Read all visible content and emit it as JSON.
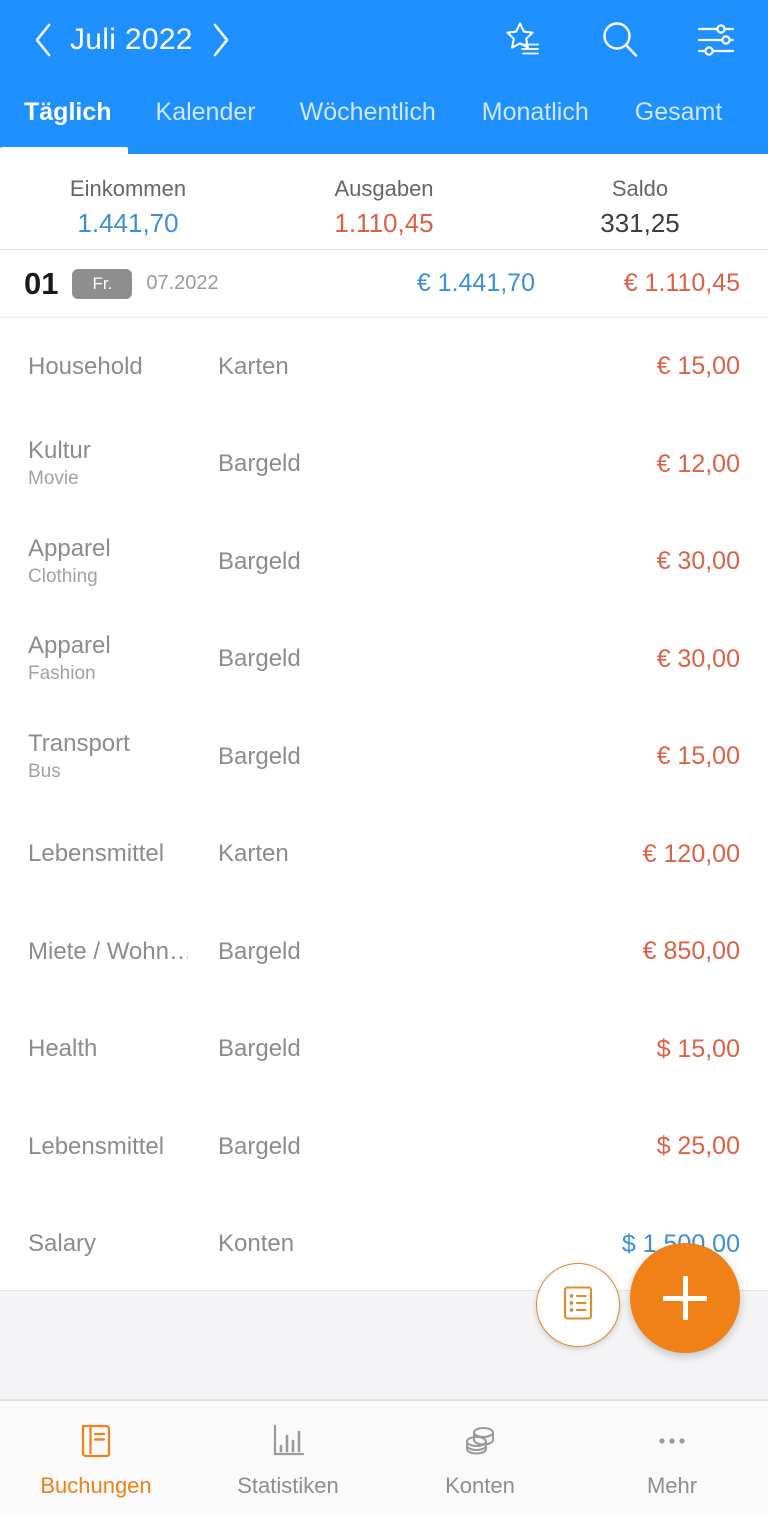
{
  "header": {
    "month_label": "Juli 2022",
    "prev_icon": "chevron-left-icon",
    "next_icon": "chevron-right-icon",
    "icons": [
      {
        "name": "star-list-icon",
        "label": "Favoriten"
      },
      {
        "name": "search-icon",
        "label": "Suche"
      },
      {
        "name": "filter-sliders-icon",
        "label": "Filter"
      }
    ],
    "accent_color": "#1E90FF"
  },
  "tabs": [
    {
      "label": "Täglich",
      "active": true
    },
    {
      "label": "Kalender",
      "active": false
    },
    {
      "label": "Wöchentlich",
      "active": false
    },
    {
      "label": "Monatlich",
      "active": false
    },
    {
      "label": "Gesamt",
      "active": false
    }
  ],
  "summary": {
    "income": {
      "label": "Einkommen",
      "value": "1.441,70",
      "color": "#3E8FD6"
    },
    "expense": {
      "label": "Ausgaben",
      "value": "1.110,45",
      "color": "#DD6146"
    },
    "balance": {
      "label": "Saldo",
      "value": "331,25",
      "color": "#3c3c3c"
    }
  },
  "date_group": {
    "day": "01",
    "weekday": "Fr.",
    "month_year": "07.2022",
    "income_total": "€ 1.441,70",
    "expense_total": "€ 1.110,45"
  },
  "transactions": [
    {
      "category": "Household",
      "subcategory": "",
      "account": "Karten",
      "amount": "€ 15,00",
      "type": "expense"
    },
    {
      "category": "Kultur",
      "subcategory": "Movie",
      "account": "Bargeld",
      "amount": "€ 12,00",
      "type": "expense"
    },
    {
      "category": "Apparel",
      "subcategory": "Clothing",
      "account": "Bargeld",
      "amount": "€ 30,00",
      "type": "expense"
    },
    {
      "category": "Apparel",
      "subcategory": "Fashion",
      "account": "Bargeld",
      "amount": "€ 30,00",
      "type": "expense"
    },
    {
      "category": "Transport",
      "subcategory": "Bus",
      "account": "Bargeld",
      "amount": "€ 15,00",
      "type": "expense"
    },
    {
      "category": "Lebensmittel",
      "subcategory": "",
      "account": "Karten",
      "amount": "€ 120,00",
      "type": "expense"
    },
    {
      "category": "Miete / Wohn…",
      "subcategory": "",
      "account": "Bargeld",
      "amount": "€ 850,00",
      "type": "expense"
    },
    {
      "category": "Health",
      "subcategory": "",
      "account": "Bargeld",
      "amount": "$ 15,00",
      "type": "expense"
    },
    {
      "category": "Lebensmittel",
      "subcategory": "",
      "account": "Bargeld",
      "amount": "$ 25,00",
      "type": "expense"
    },
    {
      "category": "Salary",
      "subcategory": "",
      "account": "Konten",
      "amount": "$ 1.500,00",
      "type": "income"
    }
  ],
  "fab": {
    "template_icon": "template-list-icon",
    "add_icon": "plus-icon",
    "add_color": "#F08018"
  },
  "bottom_nav": [
    {
      "label": "Buchungen",
      "icon": "book-icon",
      "active": true
    },
    {
      "label": "Statistiken",
      "icon": "bar-chart-icon",
      "active": false
    },
    {
      "label": "Konten",
      "icon": "coins-icon",
      "active": false
    },
    {
      "label": "Mehr",
      "icon": "ellipsis-icon",
      "active": false
    }
  ]
}
